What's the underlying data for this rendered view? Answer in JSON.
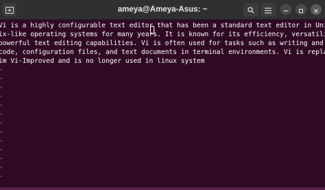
{
  "window": {
    "title": "ameya@Ameya-Asus: ~",
    "icons": {
      "new_tab": "terminal-new-tab-icon",
      "search": "search-icon",
      "menu": "hamburger-menu-icon",
      "minimize": "minimize-icon",
      "maximize": "maximize-icon",
      "close": "close-icon"
    }
  },
  "terminal": {
    "lines": [
      "Vi is a highly configurable text editor that has been a standard text editor in Unix and Un",
      "ix-like operating systems for many years. It is known for its efficiency, versatility, and",
      "powerful text editing capabilities. Vi is often used for tasks such as writing and editing",
      "code, configuration files, and text documents in terminal environments. Vi is replaced by V",
      "im Vi-Improved and is no longer used in linux system"
    ],
    "tilde": "~",
    "colors": {
      "background": "#300a24",
      "text": "#ffffff",
      "tilde": "#5d7fd6"
    }
  }
}
